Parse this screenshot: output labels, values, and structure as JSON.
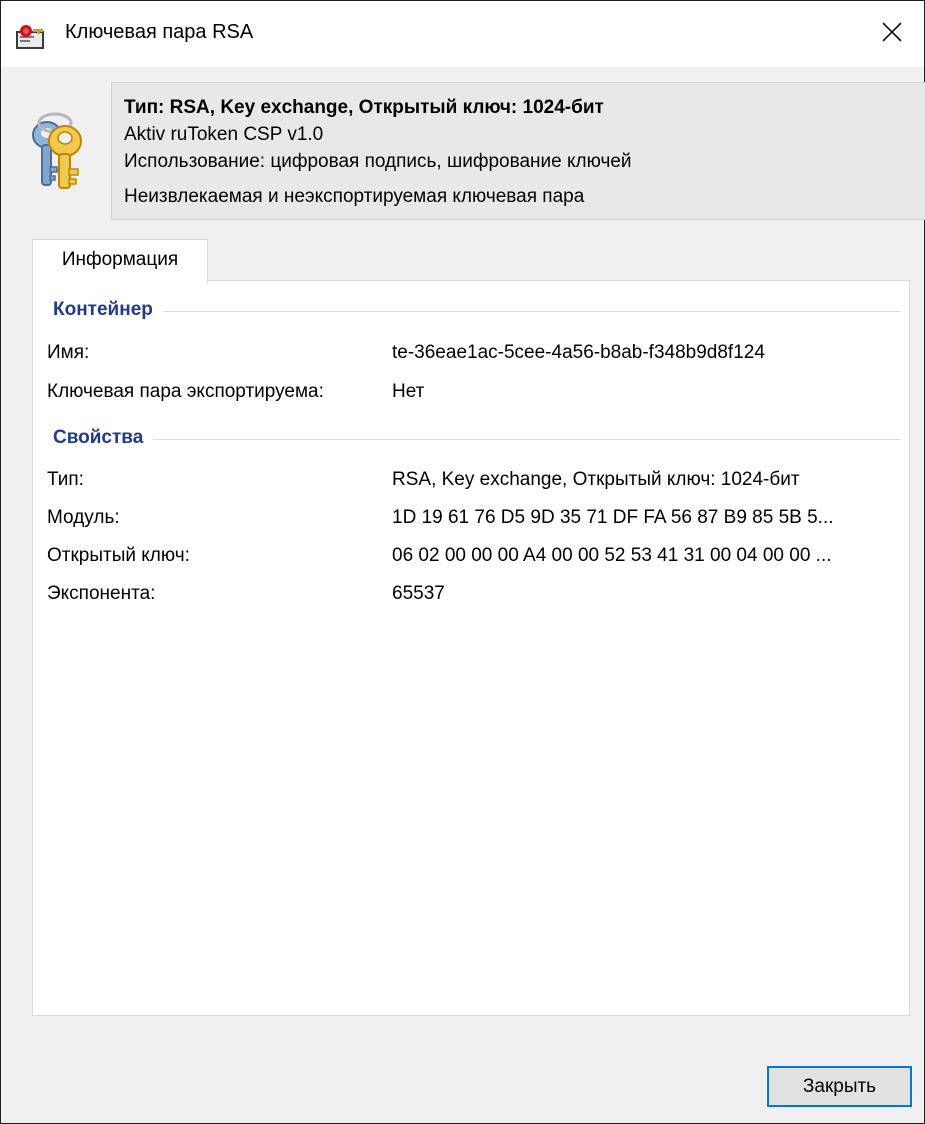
{
  "window": {
    "title": "Ключевая пара RSA",
    "app_icon": "certificate-key-icon",
    "close_icon": "close-icon"
  },
  "header": {
    "icon": "keys-icon",
    "line1": "Тип: RSA, Key exchange, Открытый ключ: 1024-бит",
    "line2": "Aktiv ruToken CSP v1.0",
    "line3": "Использование: цифровая подпись, шифрование ключей",
    "line4": "Неизвлекаемая и неэкспортируемая ключевая пара"
  },
  "tabs": [
    {
      "label": "Информация",
      "selected": true
    }
  ],
  "container_section": {
    "title": "Контейнер",
    "rows": [
      {
        "label": "Имя:",
        "value": "te-36eae1ac-5cee-4a56-b8ab-f348b9d8f124"
      },
      {
        "label": "Ключевая пара экспортируема:",
        "value": "Нет"
      }
    ]
  },
  "properties_section": {
    "title": "Свойства",
    "rows": [
      {
        "label": "Тип:",
        "value": "RSA, Key exchange, Открытый ключ: 1024-бит"
      },
      {
        "label": "Модуль:",
        "value": "1D 19 61 76 D5 9D 35 71 DF FA 56 87 B9 85 5B 5..."
      },
      {
        "label": "Открытый ключ:",
        "value": "06 02 00 00 00 A4 00 00 52 53 41 31 00 04 00 00 ..."
      },
      {
        "label": "Экспонента:",
        "value": "65537"
      }
    ]
  },
  "footer": {
    "close_label": "Закрыть"
  },
  "colors": {
    "section_title": "#1f3b8f",
    "button_border": "#0078d7",
    "dialog_bg": "#f0f0f0"
  }
}
